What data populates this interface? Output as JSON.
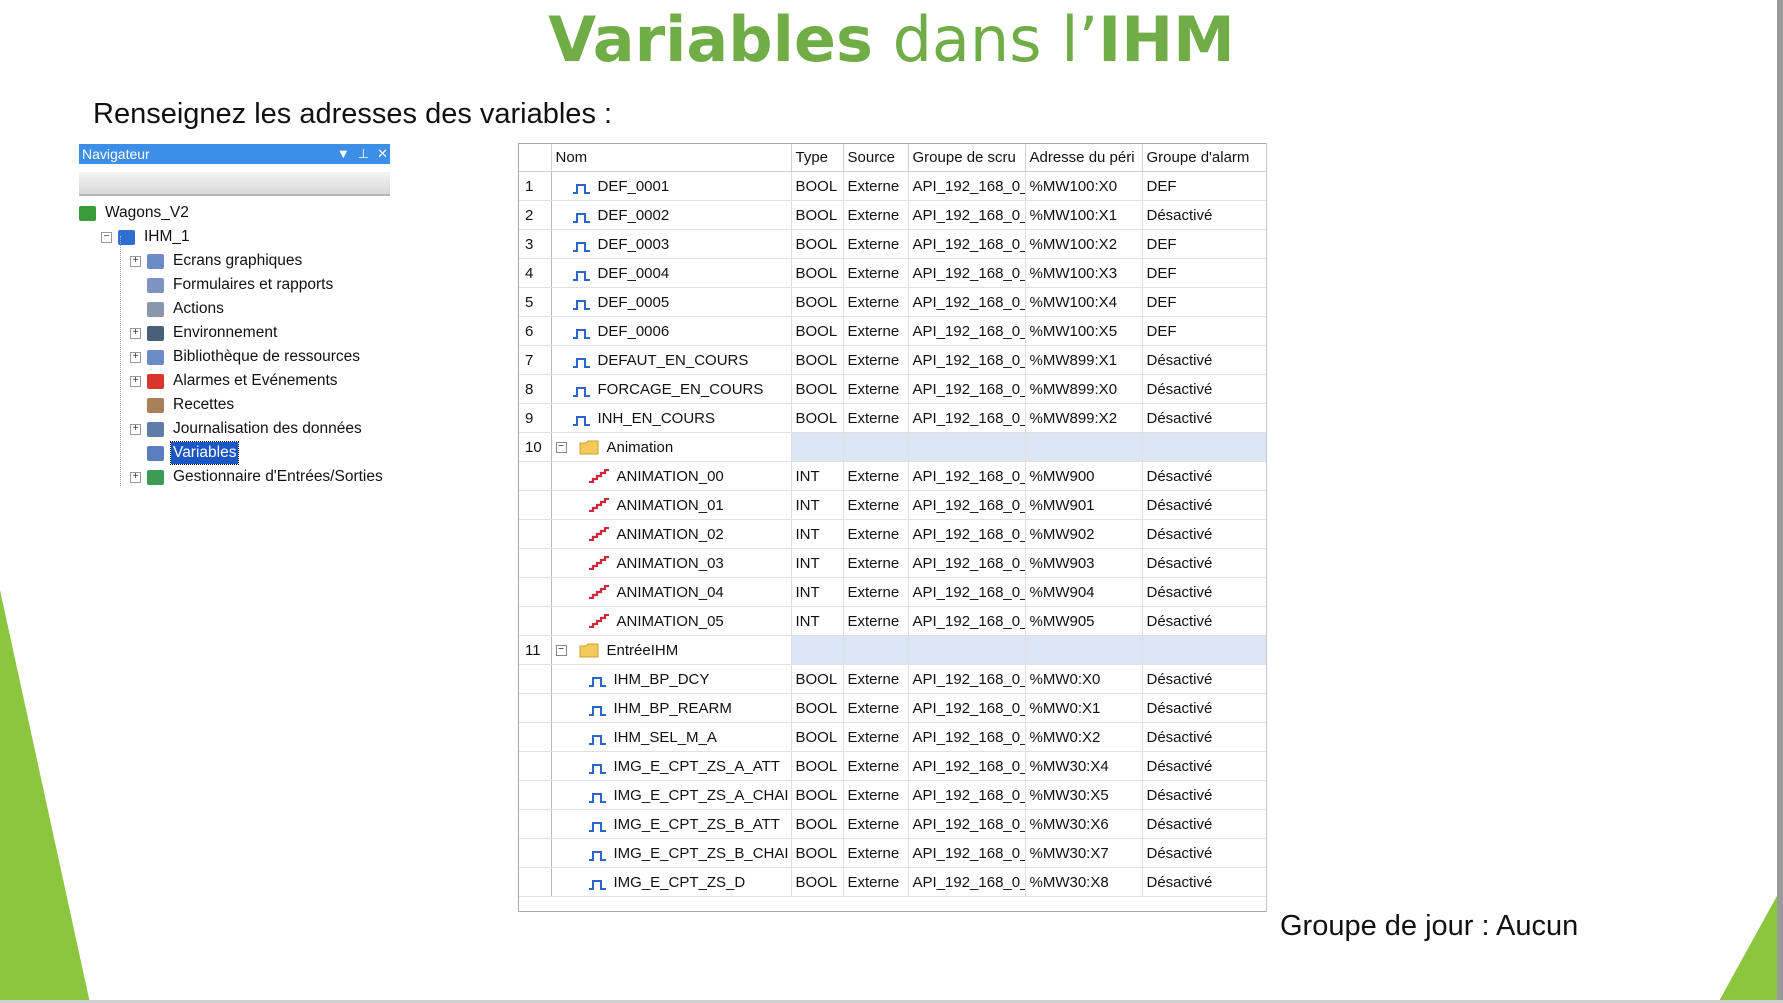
{
  "slide": {
    "title_part1": "Variables",
    "title_part2": " dans l’",
    "title_part3": "IHM",
    "subtitle": "Renseignez les adresses des variables :",
    "footnote": "Groupe de jour : Aucun"
  },
  "colors": {
    "accent": "#70ad47",
    "nav_header": "#3c8ee6",
    "group_row": "#dbe6f5"
  },
  "navigator": {
    "title": "Navigateur",
    "tree": [
      {
        "label": "Wagons_V2",
        "icon": "project-icon"
      },
      {
        "label": "IHM_1",
        "icon": "hmi-icon"
      },
      {
        "label": "Ecrans graphiques",
        "icon": "screens-icon"
      },
      {
        "label": "Formulaires et rapports",
        "icon": "forms-icon"
      },
      {
        "label": "Actions",
        "icon": "actions-icon"
      },
      {
        "label": "Environnement",
        "icon": "environment-icon"
      },
      {
        "label": "Bibliothèque de ressources",
        "icon": "library-icon"
      },
      {
        "label": "Alarmes et Evénements",
        "icon": "alarms-icon"
      },
      {
        "label": "Recettes",
        "icon": "recipes-icon"
      },
      {
        "label": "Journalisation des données",
        "icon": "logging-icon"
      },
      {
        "label": "Variables",
        "icon": "variables-icon"
      },
      {
        "label": "Gestionnaire d'Entrées/Sorties",
        "icon": "io-manager-icon"
      }
    ]
  },
  "table": {
    "headers": [
      "Nom",
      "Type",
      "Source",
      "Groupe de scru",
      "Adresse du péri",
      "Groupe d'alarm"
    ],
    "rows": [
      {
        "num": "1",
        "name": "DEF_0001",
        "type": "BOOL",
        "source": "Externe",
        "group": "API_192_168_0_",
        "address": "%MW100:X0",
        "alarm": "DEF"
      },
      {
        "num": "2",
        "name": "DEF_0002",
        "type": "BOOL",
        "source": "Externe",
        "group": "API_192_168_0_",
        "address": "%MW100:X1",
        "alarm": "Désactivé"
      },
      {
        "num": "3",
        "name": "DEF_0003",
        "type": "BOOL",
        "source": "Externe",
        "group": "API_192_168_0_",
        "address": "%MW100:X2",
        "alarm": "DEF"
      },
      {
        "num": "4",
        "name": "DEF_0004",
        "type": "BOOL",
        "source": "Externe",
        "group": "API_192_168_0_",
        "address": "%MW100:X3",
        "alarm": "DEF"
      },
      {
        "num": "5",
        "name": "DEF_0005",
        "type": "BOOL",
        "source": "Externe",
        "group": "API_192_168_0_",
        "address": "%MW100:X4",
        "alarm": "DEF"
      },
      {
        "num": "6",
        "name": "DEF_0006",
        "type": "BOOL",
        "source": "Externe",
        "group": "API_192_168_0_",
        "address": "%MW100:X5",
        "alarm": "DEF"
      },
      {
        "num": "7",
        "name": "DEFAUT_EN_COURS",
        "type": "BOOL",
        "source": "Externe",
        "group": "API_192_168_0_",
        "address": "%MW899:X1",
        "alarm": "Désactivé"
      },
      {
        "num": "8",
        "name": "FORCAGE_EN_COURS",
        "type": "BOOL",
        "source": "Externe",
        "group": "API_192_168_0_",
        "address": "%MW899:X0",
        "alarm": "Désactivé"
      },
      {
        "num": "9",
        "name": "INH_EN_COURS",
        "type": "BOOL",
        "source": "Externe",
        "group": "API_192_168_0_",
        "address": "%MW899:X2",
        "alarm": "Désactivé"
      },
      {
        "num": "10",
        "kind": "group",
        "name": "Animation"
      },
      {
        "num": "",
        "indent": true,
        "name": "ANIMATION_00",
        "type": "INT",
        "source": "Externe",
        "group": "API_192_168_0_",
        "address": "%MW900",
        "alarm": "Désactivé"
      },
      {
        "num": "",
        "indent": true,
        "name": "ANIMATION_01",
        "type": "INT",
        "source": "Externe",
        "group": "API_192_168_0_",
        "address": "%MW901",
        "alarm": "Désactivé"
      },
      {
        "num": "",
        "indent": true,
        "name": "ANIMATION_02",
        "type": "INT",
        "source": "Externe",
        "group": "API_192_168_0_",
        "address": "%MW902",
        "alarm": "Désactivé"
      },
      {
        "num": "",
        "indent": true,
        "name": "ANIMATION_03",
        "type": "INT",
        "source": "Externe",
        "group": "API_192_168_0_",
        "address": "%MW903",
        "alarm": "Désactivé"
      },
      {
        "num": "",
        "indent": true,
        "name": "ANIMATION_04",
        "type": "INT",
        "source": "Externe",
        "group": "API_192_168_0_",
        "address": "%MW904",
        "alarm": "Désactivé"
      },
      {
        "num": "",
        "indent": true,
        "name": "ANIMATION_05",
        "type": "INT",
        "source": "Externe",
        "group": "API_192_168_0_",
        "address": "%MW905",
        "alarm": "Désactivé"
      },
      {
        "num": "11",
        "kind": "group",
        "name": "EntréeIHM"
      },
      {
        "num": "",
        "indent": true,
        "name": "IHM_BP_DCY",
        "type": "BOOL",
        "source": "Externe",
        "group": "API_192_168_0_",
        "address": "%MW0:X0",
        "alarm": "Désactivé"
      },
      {
        "num": "",
        "indent": true,
        "name": "IHM_BP_REARM",
        "type": "BOOL",
        "source": "Externe",
        "group": "API_192_168_0_",
        "address": "%MW0:X1",
        "alarm": "Désactivé"
      },
      {
        "num": "",
        "indent": true,
        "name": "IHM_SEL_M_A",
        "type": "BOOL",
        "source": "Externe",
        "group": "API_192_168_0_",
        "address": "%MW0:X2",
        "alarm": "Désactivé"
      },
      {
        "num": "",
        "indent": true,
        "name": "IMG_E_CPT_ZS_A_ATT",
        "type": "BOOL",
        "source": "Externe",
        "group": "API_192_168_0_",
        "address": "%MW30:X4",
        "alarm": "Désactivé"
      },
      {
        "num": "",
        "indent": true,
        "name": "IMG_E_CPT_ZS_A_CHAI",
        "type": "BOOL",
        "source": "Externe",
        "group": "API_192_168_0_",
        "address": "%MW30:X5",
        "alarm": "Désactivé"
      },
      {
        "num": "",
        "indent": true,
        "name": "IMG_E_CPT_ZS_B_ATT",
        "type": "BOOL",
        "source": "Externe",
        "group": "API_192_168_0_",
        "address": "%MW30:X6",
        "alarm": "Désactivé"
      },
      {
        "num": "",
        "indent": true,
        "name": "IMG_E_CPT_ZS_B_CHAI",
        "type": "BOOL",
        "source": "Externe",
        "group": "API_192_168_0_",
        "address": "%MW30:X7",
        "alarm": "Désactivé"
      },
      {
        "num": "",
        "indent": true,
        "name": "IMG_E_CPT_ZS_D",
        "type": "BOOL",
        "source": "Externe",
        "group": "API_192_168_0_",
        "address": "%MW30:X8",
        "alarm": "Désactivé"
      }
    ]
  }
}
